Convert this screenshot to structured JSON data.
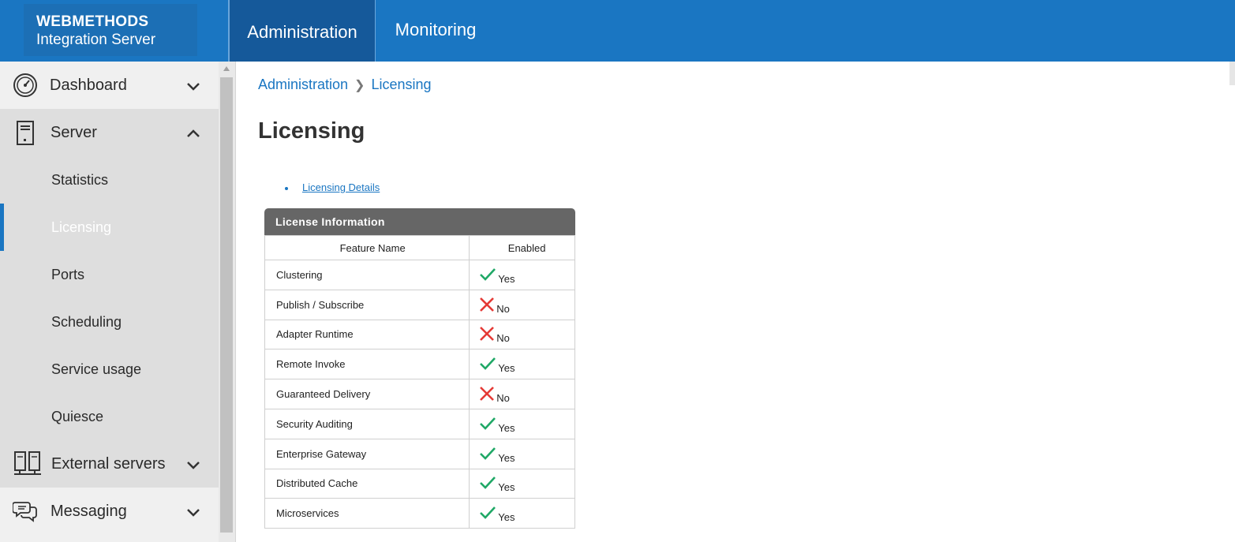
{
  "brand": {
    "line1": "WEBMETHODS",
    "line2": "Integration Server"
  },
  "nav_tabs": [
    {
      "label": "Administration",
      "active": true
    },
    {
      "label": "Monitoring",
      "active": false
    }
  ],
  "sidebar": {
    "dashboard": "Dashboard",
    "server": "Server",
    "server_items": [
      "Statistics",
      "Licensing",
      "Ports",
      "Scheduling",
      "Service usage",
      "Quiesce"
    ],
    "selected": "Licensing",
    "external_servers": "External servers",
    "messaging": "Messaging"
  },
  "breadcrumb": {
    "parent": "Administration",
    "current": "Licensing"
  },
  "page_title": "Licensing",
  "links": {
    "licensing_details": "Licensing Details"
  },
  "license_table": {
    "title": "License Information",
    "headers": {
      "feature": "Feature Name",
      "enabled": "Enabled"
    },
    "rows": [
      {
        "feature": "Clustering",
        "enabled": "Yes"
      },
      {
        "feature": "Publish / Subscribe",
        "enabled": "No"
      },
      {
        "feature": "Adapter Runtime",
        "enabled": "No"
      },
      {
        "feature": "Remote Invoke",
        "enabled": "Yes"
      },
      {
        "feature": "Guaranteed Delivery",
        "enabled": "No"
      },
      {
        "feature": "Security Auditing",
        "enabled": "Yes"
      },
      {
        "feature": "Enterprise Gateway",
        "enabled": "Yes"
      },
      {
        "feature": "Distributed Cache",
        "enabled": "Yes"
      },
      {
        "feature": "Microservices",
        "enabled": "Yes"
      }
    ]
  },
  "colors": {
    "header_blue": "#1a76c2",
    "active_tab": "#15599a",
    "yes_green": "#1fa866",
    "no_red": "#e53935",
    "table_header": "#666666"
  }
}
